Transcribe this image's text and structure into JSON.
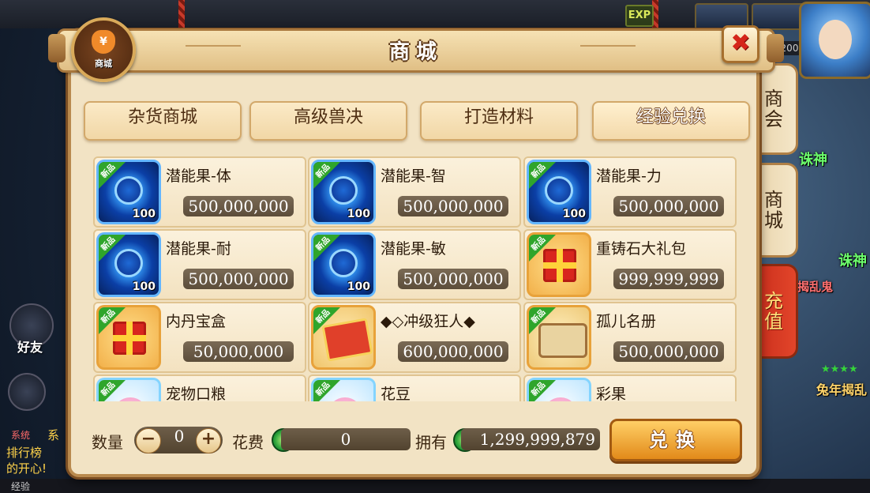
{
  "world": {
    "exp_badge": "EXP",
    "level_number": "200",
    "name_text_1": "诛神",
    "name_text_2": "诛神",
    "name_text_3": "揭乱鬼",
    "name_text_4": "兔年揭乱",
    "friend_label": "好友",
    "chat_tag": "系统",
    "chat_line_1": "系",
    "chat_line_2": "排行榜",
    "chat_line_3": "的开心!",
    "bottom_text": "经验"
  },
  "shop": {
    "title": "商城",
    "emblem_label": "商城",
    "emblem_symbol": "¥",
    "close_symbol": "✖",
    "categories": [
      {
        "label": "杂货商城",
        "active": false
      },
      {
        "label": "高级兽决",
        "active": false
      },
      {
        "label": "打造材料",
        "active": false
      },
      {
        "label": "经验兑换",
        "active": true
      }
    ],
    "new_badge": "新品",
    "items": [
      {
        "name": "潜能果-体",
        "price": "500,000,000",
        "qty": "100",
        "icon": "potential-fruit-icon",
        "kind": "fruit"
      },
      {
        "name": "潜能果-智",
        "price": "500,000,000",
        "qty": "100",
        "icon": "potential-fruit-icon",
        "kind": "fruit"
      },
      {
        "name": "潜能果-力",
        "price": "500,000,000",
        "qty": "100",
        "icon": "potential-fruit-icon",
        "kind": "fruit"
      },
      {
        "name": "潜能果-耐",
        "price": "500,000,000",
        "qty": "100",
        "icon": "potential-fruit-icon",
        "kind": "fruit"
      },
      {
        "name": "潜能果-敏",
        "price": "500,000,000",
        "qty": "100",
        "icon": "potential-fruit-icon",
        "kind": "fruit"
      },
      {
        "name": "重铸石大礼包",
        "price": "999,999,999",
        "qty": "",
        "icon": "gift-box-icon",
        "kind": "gift"
      },
      {
        "name": "内丹宝盒",
        "price": "50,000,000",
        "qty": "",
        "icon": "gift-box-icon",
        "kind": "gift"
      },
      {
        "name": "◆◇冲级狂人◆",
        "price": "600,000,000",
        "qty": "",
        "icon": "ticket-icon",
        "kind": "ticket"
      },
      {
        "name": "孤儿名册",
        "price": "500,000,000",
        "qty": "",
        "icon": "scroll-icon",
        "kind": "scroll"
      },
      {
        "name": "宠物口粮",
        "price": "",
        "qty": "",
        "icon": "pet-food-icon",
        "kind": "pet"
      },
      {
        "name": "花豆",
        "price": "",
        "qty": "",
        "icon": "bean-icon",
        "kind": "pet"
      },
      {
        "name": "彩果",
        "price": "",
        "qty": "",
        "icon": "color-fruit-icon",
        "kind": "pet"
      }
    ],
    "footer": {
      "qty_label": "数量",
      "qty_minus": "−",
      "qty_plus": "+",
      "qty_value": "0",
      "cost_label": "花费",
      "cost_value": "0",
      "own_label": "拥有",
      "own_value": "1,299,999,879",
      "exchange_label": "兑换"
    },
    "side_tabs": [
      {
        "label": "商会"
      },
      {
        "label": "商城"
      },
      {
        "label": "充值"
      }
    ]
  }
}
